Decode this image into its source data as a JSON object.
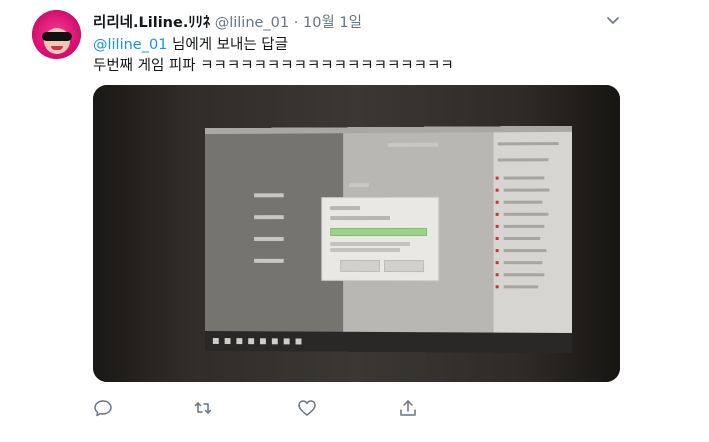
{
  "tweet": {
    "display_name": "리리네.Liline.",
    "display_name_suffix": "ﾘﾘﾈ",
    "handle": "@liline_01",
    "separator": "·",
    "date": "10월 1일",
    "reply_mention": "@liline_01",
    "reply_suffix": " 님에게 보내는 답글",
    "text": "두번째 게임 피파 ㅋㅋㅋㅋㅋㅋㅋㅋㅋㅋㅋㅋㅋㅋㅋㅋㅋㅋㅋ"
  },
  "icons": {
    "avatar": "avatar",
    "menu": "chevron-down-icon",
    "reply": "reply-icon",
    "retweet": "retweet-icon",
    "like": "like-icon",
    "share": "share-icon"
  },
  "colors": {
    "link": "#1b95e0",
    "secondary_text": "#657786",
    "primary_text": "#14171a",
    "icon": "#657786"
  }
}
